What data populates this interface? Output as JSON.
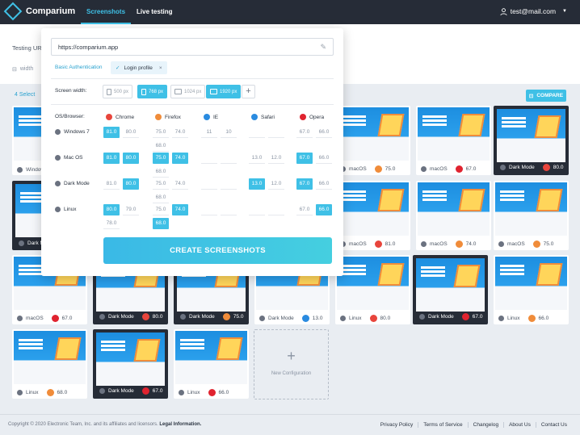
{
  "brand": {
    "name": "Comparium"
  },
  "nav": [
    "Screenshots",
    "Live testing"
  ],
  "account": {
    "email": "test@mail.com"
  },
  "page": {
    "testing_label": "Testing URL",
    "width_label": "width",
    "selected": "4 Select",
    "compare": "COMPARE"
  },
  "panel": {
    "url": "https://comparium.app",
    "basic_auth": "Basic Authentication",
    "login_profile": "Login profile",
    "screen_width_label": "Screen width:",
    "widths": [
      "500 px",
      "768 px",
      "1024 px",
      "1920 px"
    ],
    "os_browser_label": "OS/Browser:",
    "browsers": [
      {
        "name": "Chrome",
        "color": "#e8453c"
      },
      {
        "name": "Firefox",
        "color": "#f08c3a"
      },
      {
        "name": "IE",
        "color": "#2a8be0"
      },
      {
        "name": "Safari",
        "color": "#2a8be0"
      },
      {
        "name": "Opera",
        "color": "#e0232f"
      }
    ],
    "os": [
      "Windows 7",
      "Mac OS",
      "Dark Mode",
      "Linux"
    ],
    "matrix": [
      [
        [
          "81.0",
          "80.0"
        ],
        [
          "75.0",
          "74.0",
          "68.0"
        ],
        [
          "11",
          "10"
        ],
        [],
        [
          "67.0",
          "66.0"
        ]
      ],
      [
        [
          "81.0",
          "80.0"
        ],
        [
          "75.0",
          "74.0",
          "68.0"
        ],
        [],
        [
          "13.0",
          "12.0"
        ],
        [
          "67.0",
          "66.0"
        ]
      ],
      [
        [
          "81.0",
          "80.0"
        ],
        [
          "75.0",
          "74.0",
          "68.0"
        ],
        [],
        [
          "13.0",
          "12.0"
        ],
        [
          "67.0",
          "66.0"
        ]
      ],
      [
        [
          "80.0",
          "79.0",
          "78.0"
        ],
        [
          "75.0",
          "74.0",
          "68.0"
        ],
        [],
        [],
        [
          "67.0",
          "66.0"
        ]
      ]
    ],
    "create_label": "CREATE SCREENSHOTS"
  },
  "cards": [
    {
      "os": "Windows",
      "ver": "",
      "b": "",
      "dark": false
    },
    {
      "os": "macOS",
      "ver": "75.0",
      "b": "firefox",
      "dark": false
    },
    {
      "os": "macOS",
      "ver": "67.0",
      "b": "opera",
      "dark": false
    },
    {
      "os": "Dark Mode",
      "ver": "80.0",
      "b": "chrome",
      "dark": true
    },
    {
      "os": "Dark M",
      "ver": "",
      "b": "",
      "dark": true
    },
    {
      "os": "macOS",
      "ver": "81.0",
      "b": "chrome",
      "dark": false
    },
    {
      "os": "macOS",
      "ver": "74.0",
      "b": "firefox",
      "dark": false
    },
    {
      "os": "macOS",
      "ver": "75.0",
      "b": "firefox",
      "dark": false
    },
    {
      "os": "macOS",
      "ver": "67.0",
      "b": "opera",
      "dark": false
    },
    {
      "os": "Dark Mode",
      "ver": "80.0",
      "b": "chrome",
      "dark": true
    },
    {
      "os": "Dark Mode",
      "ver": "75.0",
      "b": "firefox",
      "dark": true
    },
    {
      "os": "Dark Mode",
      "ver": "13.0",
      "b": "safari",
      "dark": false
    },
    {
      "os": "Linux",
      "ver": "80.0",
      "b": "chrome",
      "dark": false
    },
    {
      "os": "Linux",
      "ver": "66.0",
      "b": "opera",
      "dark": false
    },
    {
      "os": "Dark Mode",
      "ver": "67.0",
      "b": "opera",
      "dark": true
    },
    {
      "os": "Linux",
      "ver": "66.0",
      "b": "firefox",
      "dark": false
    },
    {
      "os": "Linux",
      "ver": "68.0",
      "b": "firefox",
      "dark": false
    },
    {
      "os": "Dark Mode",
      "ver": "67.0",
      "b": "opera",
      "dark": true
    },
    {
      "os": "Linux",
      "ver": "66.0",
      "b": "opera",
      "dark": false
    }
  ],
  "new_config": "New Configuration",
  "footer": {
    "copyright": "Copyright © 2020 Electronic Team, Inc. and its affiliates and licensors.",
    "legal": "Legal Information.",
    "links": [
      "Privacy Policy",
      "Terms of Service",
      "Changelog",
      "About Us",
      "Contact Us"
    ]
  },
  "colors": {
    "accent": "#3fc0e6",
    "topbar": "#262c37"
  }
}
